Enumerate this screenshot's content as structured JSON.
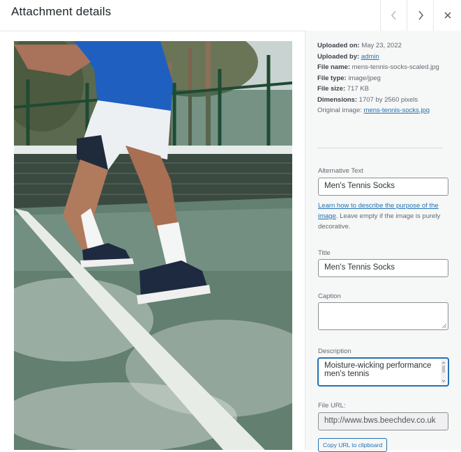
{
  "header": {
    "title": "Attachment details",
    "prev_label": "Previous",
    "next_label": "Next",
    "close_label": "Close"
  },
  "media": {
    "alt": "Men's Tennis Socks"
  },
  "details": {
    "uploaded_on_label": "Uploaded on:",
    "uploaded_on_value": "May 23, 2022",
    "uploaded_by_label": "Uploaded by:",
    "uploaded_by_value": "admin",
    "file_name_label": "File name:",
    "file_name_value": "mens-tennis-socks-scaled.jpg",
    "file_type_label": "File type:",
    "file_type_value": "image/jpeg",
    "file_size_label": "File size:",
    "file_size_value": "717 KB",
    "dimensions_label": "Dimensions:",
    "dimensions_value": "1707 by 2560 pixels",
    "original_image_label": "Original image:",
    "original_image_value": "mens-tennis-socks.jpg"
  },
  "form": {
    "alt_text_label": "Alternative Text",
    "alt_text_value": "Men's Tennis Socks",
    "help_link": "Learn how to describe the purpose of the image",
    "help_text": ". Leave empty if the image is purely decorative.",
    "title_label": "Title",
    "title_value": "Men's Tennis Socks",
    "caption_label": "Caption",
    "caption_value": "",
    "description_label": "Description",
    "description_value": "Moisture-wicking performance men's tennis",
    "file_url_label": "File URL:",
    "file_url_value": "http://www.bws.beechdev.co.uk",
    "copy_button": "Copy URL to clipboard"
  },
  "colors": {
    "accent": "#2271b1",
    "court": "#5f7a6c",
    "line_white": "#e8ece6"
  }
}
